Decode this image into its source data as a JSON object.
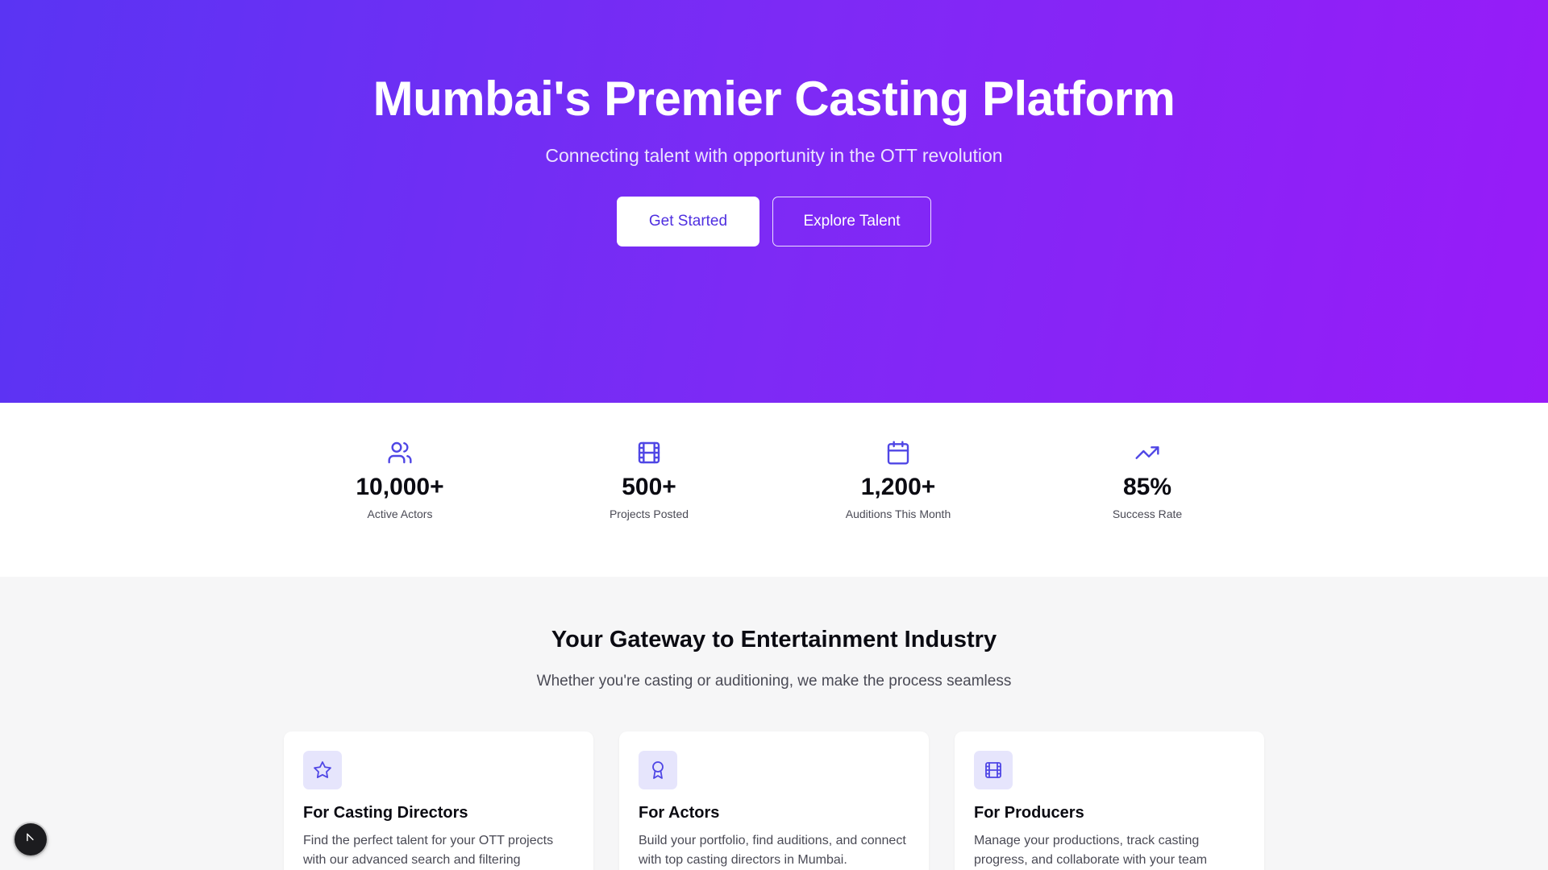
{
  "hero": {
    "title": "Mumbai's Premier Casting Platform",
    "subtitle": "Connecting talent with opportunity in the OTT revolution",
    "primary_button": "Get Started",
    "secondary_button": "Explore Talent"
  },
  "stats": [
    {
      "icon": "users-icon",
      "value": "10,000+",
      "label": "Active Actors"
    },
    {
      "icon": "film-icon",
      "value": "500+",
      "label": "Projects Posted"
    },
    {
      "icon": "calendar-icon",
      "value": "1,200+",
      "label": "Auditions This Month"
    },
    {
      "icon": "trending-up-icon",
      "value": "85%",
      "label": "Success Rate"
    }
  ],
  "features": {
    "title": "Your Gateway to Entertainment Industry",
    "subtitle": "Whether you're casting or auditioning, we make the process seamless",
    "cards": [
      {
        "icon": "star-icon",
        "title": "For Casting Directors",
        "description": "Find the perfect talent for your OTT projects with our advanced search and filtering"
      },
      {
        "icon": "award-icon",
        "title": "For Actors",
        "description": "Build your portfolio, find auditions, and connect with top casting directors in Mumbai."
      },
      {
        "icon": "film-icon",
        "title": "For Producers",
        "description": "Manage your productions, track casting progress, and collaborate with your team"
      }
    ]
  },
  "colors": {
    "gradient_start": "#5a34f3",
    "gradient_end": "#981bf8",
    "accent": "#4f2fe0",
    "icon_tile": "#e6e5fc"
  },
  "floating_button_icon": "cursor-icon"
}
